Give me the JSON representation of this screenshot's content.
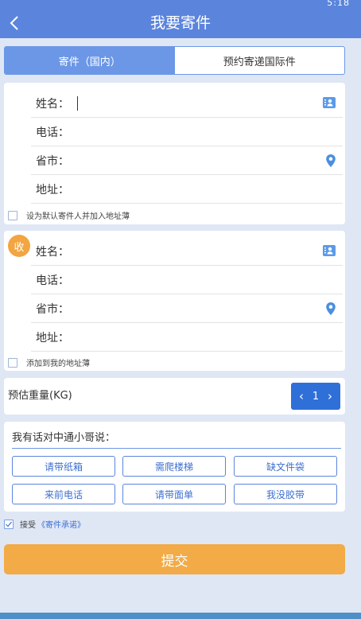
{
  "status": {
    "time": "5:18"
  },
  "header": {
    "title": "我要寄件"
  },
  "tabs": [
    {
      "label": "寄件（国内）",
      "active": true
    },
    {
      "label": "预约寄递国际件",
      "active": false
    }
  ],
  "sender": {
    "fields": [
      "姓名：",
      "电话：",
      "省市：",
      "地址："
    ],
    "checkbox_label": "设为默认寄件人并加入地址薄"
  },
  "receiver": {
    "badge": "收",
    "fields": [
      "姓名：",
      "电话：",
      "省市：",
      "地址："
    ],
    "checkbox_label": "添加到我的地址薄"
  },
  "weight": {
    "label": "预估重量(KG)",
    "value": "1",
    "dec": "‹",
    "inc": "›"
  },
  "remarks": {
    "title": "我有话对中通小哥说：",
    "chips": [
      "请带纸箱",
      "需爬楼梯",
      "缺文件袋",
      "来前电话",
      "请带面单",
      "我没胶带"
    ]
  },
  "agree": {
    "text": "接受",
    "link": "《寄件承诺》",
    "checked": true
  },
  "submit": {
    "label": "提交"
  },
  "colors": {
    "primary": "#5b85dd",
    "accent": "#f2ab46",
    "button_blue": "#2f6fd8"
  },
  "icons": [
    "back-arrow-icon",
    "contact-book-icon",
    "location-pin-icon",
    "check-icon"
  ]
}
